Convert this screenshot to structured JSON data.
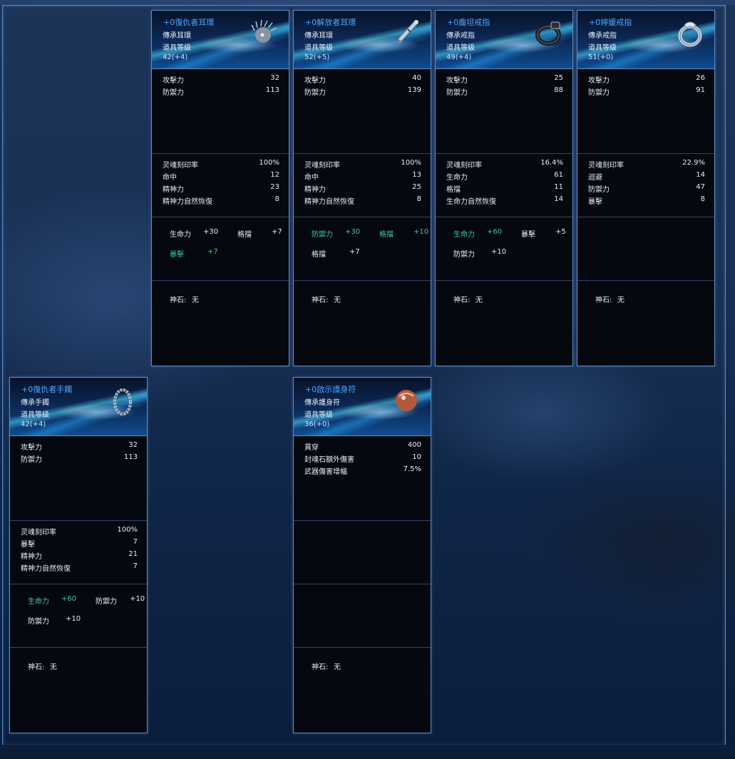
{
  "cards": [
    {
      "title": "+0復仇者耳環",
      "type": "傳承耳環",
      "level_label": "道具等级",
      "level": "42(+4)",
      "icon": "pearl-earring-icon",
      "base": [
        {
          "k": "攻擊力",
          "v": "32"
        },
        {
          "k": "防禦力",
          "v": "113"
        }
      ],
      "attrs": [
        {
          "k": "灵魂刻印率",
          "v": "100%"
        },
        {
          "k": "命中",
          "v": "12"
        },
        {
          "k": "精神力",
          "v": "23"
        },
        {
          "k": "精神力自然恢復",
          "v": "8"
        }
      ],
      "bonus": [
        {
          "k": "生命力",
          "v": "+30",
          "green": false
        },
        {
          "k": "格擋",
          "v": "+7",
          "green": false
        },
        {
          "k": "暴擊",
          "v": "+7",
          "green": true
        }
      ],
      "gem_label": "神石:",
      "gem_value": "无"
    },
    {
      "title": "+0解放者耳環",
      "type": "傳承耳環",
      "level_label": "道具等级",
      "level": "52(+5)",
      "icon": "dagger-earring-icon",
      "base": [
        {
          "k": "攻擊力",
          "v": "40"
        },
        {
          "k": "防禦力",
          "v": "139"
        }
      ],
      "attrs": [
        {
          "k": "灵魂刻印率",
          "v": "100%"
        },
        {
          "k": "命中",
          "v": "13"
        },
        {
          "k": "精神力",
          "v": "25"
        },
        {
          "k": "精神力自然恢復",
          "v": "8"
        }
      ],
      "bonus": [
        {
          "k": "防禦力",
          "v": "+30",
          "green": true
        },
        {
          "k": "格擋",
          "v": "+10",
          "green": true
        },
        {
          "k": "格擋",
          "v": "+7",
          "green": false
        }
      ],
      "gem_label": "神石:",
      "gem_value": "无"
    },
    {
      "title": "+0龐坦戒指",
      "type": "傳承戒指",
      "level_label": "道具等级",
      "level": "49(+4)",
      "icon": "black-ring-icon",
      "base": [
        {
          "k": "攻擊力",
          "v": "25"
        },
        {
          "k": "防禦力",
          "v": "88"
        }
      ],
      "attrs": [
        {
          "k": "灵魂刻印率",
          "v": "16.4%"
        },
        {
          "k": "生命力",
          "v": "61"
        },
        {
          "k": "格擋",
          "v": "11"
        },
        {
          "k": "生命力自然恢復",
          "v": "14"
        }
      ],
      "bonus": [
        {
          "k": "生命力",
          "v": "+60",
          "green": true
        },
        {
          "k": "暴擊",
          "v": "+5",
          "green": false
        },
        {
          "k": "防禦力",
          "v": "+10",
          "green": false
        }
      ],
      "gem_label": "神石:",
      "gem_value": "无"
    },
    {
      "title": "+0婷媛戒指",
      "type": "傳承戒指",
      "level_label": "道具等级",
      "level": "51(+0)",
      "icon": "silver-ring-icon",
      "base": [
        {
          "k": "攻擊力",
          "v": "26"
        },
        {
          "k": "防禦力",
          "v": "91"
        }
      ],
      "attrs": [
        {
          "k": "灵魂刻印率",
          "v": "22.9%"
        },
        {
          "k": "迴避",
          "v": "14"
        },
        {
          "k": "防禦力",
          "v": "47"
        },
        {
          "k": "暴擊",
          "v": "8"
        }
      ],
      "bonus": [],
      "gem_label": "神石:",
      "gem_value": "无"
    },
    {
      "title": "+0復仇者手鐲",
      "type": "傳承手鐲",
      "level_label": "道具等级",
      "level": "42(+4)",
      "icon": "bracelet-icon",
      "base": [
        {
          "k": "攻擊力",
          "v": "32"
        },
        {
          "k": "防禦力",
          "v": "113"
        }
      ],
      "attrs": [
        {
          "k": "灵魂刻印率",
          "v": "100%"
        },
        {
          "k": "暴擊",
          "v": "7"
        },
        {
          "k": "精神力",
          "v": "21"
        },
        {
          "k": "精神力自然恢復",
          "v": "7"
        }
      ],
      "bonus": [
        {
          "k": "生命力",
          "v": "+60",
          "green": true
        },
        {
          "k": "防禦力",
          "v": "+10",
          "green": false
        },
        {
          "k": "防禦力",
          "v": "+10",
          "green": false
        }
      ],
      "gem_label": "神石:",
      "gem_value": "无"
    },
    {
      "title": "+0啟示護身符",
      "type": "傳承護身符",
      "level_label": "道具等级",
      "level": "36(+0)",
      "icon": "amulet-orb-icon",
      "base": [
        {
          "k": "貫穿",
          "v": "400"
        },
        {
          "k": "封魂石額外傷害",
          "v": "10"
        },
        {
          "k": "武器傷害增幅",
          "v": "7.5%"
        }
      ],
      "attrs": [],
      "bonus": [],
      "gem_label": "神石:",
      "gem_value": "无"
    }
  ]
}
